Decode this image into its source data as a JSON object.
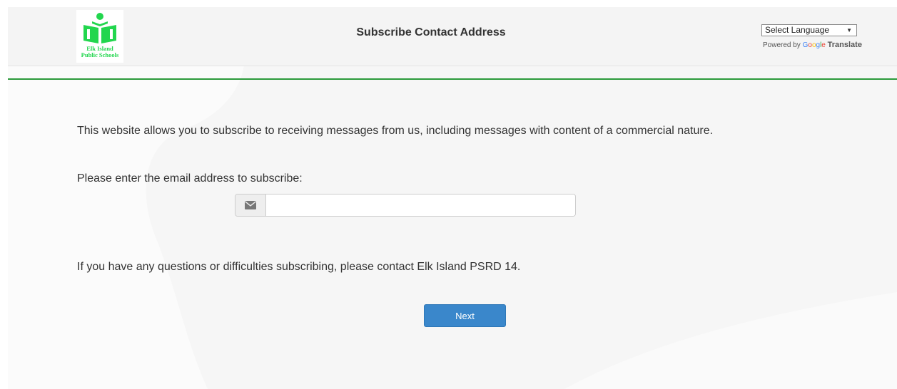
{
  "header": {
    "logo_text": [
      "Elk Island",
      "Public Schools"
    ],
    "title": "Subscribe Contact Address",
    "language_select": {
      "selected": "Select Language",
      "arrow": "▼"
    },
    "powered_by": {
      "prefix": "Powered by",
      "google": [
        "G",
        "o",
        "o",
        "g",
        "l",
        "e"
      ],
      "translate": "Translate"
    }
  },
  "main": {
    "intro": "This website allows you to subscribe to receiving messages from us, including messages with content of a commercial nature.",
    "prompt": "Please enter the email address to subscribe:",
    "email": {
      "value": "",
      "placeholder": "",
      "icon": "envelope-icon"
    },
    "help": "If you have any questions or difficulties subscribing, please contact Elk Island PSRD 14.",
    "next_label": "Next"
  },
  "colors": {
    "accent_green": "#2b9a3a",
    "logo_green": "#22d64e",
    "button_blue": "#3a87cb"
  }
}
